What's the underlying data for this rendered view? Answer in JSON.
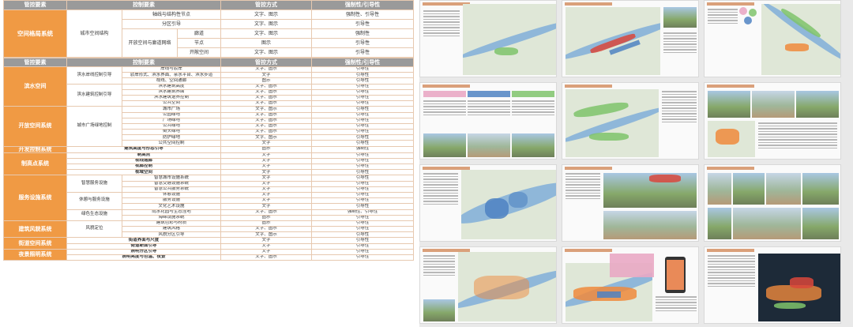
{
  "table_top": {
    "headers": [
      "管控要素",
      "控制要素",
      "管控方式",
      "强制性/引导性"
    ],
    "system": "空间格局系统",
    "group": "城市空间结构",
    "rows": [
      {
        "el": "轴线与结构性节点",
        "sub": "",
        "way": "文字、图示",
        "type": "强制性、引导性"
      },
      {
        "el": "分区引导",
        "sub": "",
        "way": "文字、图示",
        "type": "引导性"
      },
      {
        "el": "开放空间与廊道网络",
        "sub": "廊道",
        "way": "文字、图示",
        "type": "强制性"
      },
      {
        "el": "",
        "sub": "节点",
        "way": "图示",
        "type": "引导性"
      },
      {
        "el": "",
        "sub": "开敞空间",
        "way": "文字、图示",
        "type": "引导性"
      }
    ]
  },
  "table_main": {
    "headers": [
      "管控要素",
      "控制要素",
      "管控方式",
      "强制性/引导性"
    ],
    "systems": [
      {
        "name": "滨水空间",
        "groups": [
          {
            "name": "滨水岸线控制引导",
            "items": [
              {
                "el": "岸线与驳岸",
                "way": "文字、图示",
                "type": "引导性"
              },
              {
                "el": "驳岸形式、滨水界面、亲水平台、滨水步道",
                "way": "文字",
                "type": "引导性"
              },
              {
                "el": "视线、空间通廊",
                "way": "图示",
                "type": "引导性"
              }
            ]
          },
          {
            "name": "滨水建筑控制引导",
            "items": [
              {
                "el": "滨水建筑高度",
                "way": "文字、图示",
                "type": "引导性"
              },
              {
                "el": "滨水建筑界面",
                "way": "文字、图示",
                "type": "引导性"
              },
              {
                "el": "滨水建筑退界控制",
                "way": "文字、图示",
                "type": "引导性"
              },
              {
                "el": "公共空间",
                "way": "文字、图示",
                "type": "引导性"
              }
            ]
          }
        ]
      },
      {
        "name": "开放空间系统",
        "groups": [
          {
            "name": "城市广场绿地控制",
            "items": [
              {
                "el": "城市广场",
                "way": "文字、图示",
                "type": "引导性"
              },
              {
                "el": "公园绿地",
                "way": "文字、图示",
                "type": "引导性"
              },
              {
                "el": "广场绿地",
                "way": "文字、图示",
                "type": "引导性"
              },
              {
                "el": "公共绿地",
                "way": "文字、图示",
                "type": "引导性"
              },
              {
                "el": "街头绿地",
                "way": "文字、图示",
                "type": "引导性"
              },
              {
                "el": "防护绿地",
                "way": "文字、图示",
                "type": "引导性"
              },
              {
                "el": "公共空间控制",
                "way": "文字",
                "type": "引导性"
              }
            ]
          }
        ]
      },
      {
        "name": "开发控制系统",
        "groups": [
          {
            "name": "",
            "items": [
              {
                "el": "建筑高度与形态引导",
                "way": "图示",
                "type": "强制性"
              }
            ]
          }
        ]
      },
      {
        "name": "制高点系统",
        "groups": [
          {
            "name": "",
            "items": [
              {
                "el": "制高点",
                "way": "文字",
                "type": "引导性"
              },
              {
                "el": "视线通廊",
                "way": "文字",
                "type": "引导性"
              },
              {
                "el": "视廊控制",
                "way": "文字",
                "type": "引导性"
              },
              {
                "el": "视域空间",
                "way": "文字",
                "type": "引导性"
              }
            ]
          }
        ]
      },
      {
        "name": "服务设施系统",
        "groups": [
          {
            "name": "智慧服务设施",
            "items": [
              {
                "el": "智慧城市设施系统",
                "way": "文字",
                "type": "引导性"
              },
              {
                "el": "智慧交通设施系统",
                "way": "文字",
                "type": "引导性"
              },
              {
                "el": "智慧公共服务系统",
                "way": "文字",
                "type": "引导性"
              }
            ]
          },
          {
            "name": "休憩与服务设施",
            "items": [
              {
                "el": "休憩设施",
                "way": "文字",
                "type": "引导性"
              },
              {
                "el": "服务设施",
                "way": "文字",
                "type": "引导性"
              },
              {
                "el": "文化艺术设施",
                "way": "文字",
                "type": "引导性"
              }
            ]
          },
          {
            "name": "绿色生态设施",
            "items": [
              {
                "el": "雨水花园与生态洼地",
                "way": "文字、图示",
                "type": "强制性、引导性"
              },
              {
                "el": "海绵设施系统",
                "way": "图示",
                "type": "引导性"
              }
            ]
          }
        ]
      },
      {
        "name": "建筑风貌系统",
        "groups": [
          {
            "name": "风貌定位",
            "items": [
              {
                "el": "建筑色彩与材质",
                "way": "图示",
                "type": "引导性"
              },
              {
                "el": "建筑风格",
                "way": "文字、图示",
                "type": "引导性"
              },
              {
                "el": "风貌分区引导",
                "way": "文字、图示",
                "type": "引导性"
              }
            ]
          }
        ]
      },
      {
        "name": "街道空间系统",
        "groups": [
          {
            "name": "",
            "items": [
              {
                "el": "街道界面与尺度",
                "way": "文字",
                "type": "引导性"
              },
              {
                "el": "街道断面引导",
                "way": "文字",
                "type": "引导性"
              }
            ]
          }
        ]
      },
      {
        "name": "夜景照明系统",
        "groups": [
          {
            "name": "",
            "items": [
              {
                "el": "照明分区引导",
                "way": "文字",
                "type": "引导性"
              },
              {
                "el": "照明亮度与色温、夜景",
                "way": "文字、图示",
                "type": "引导性"
              }
            ]
          }
        ]
      }
    ]
  },
  "thumbnails": [
    {
      "name": "thumb-1"
    },
    {
      "name": "thumb-2"
    },
    {
      "name": "thumb-3"
    },
    {
      "name": "thumb-4"
    },
    {
      "name": "thumb-5"
    },
    {
      "name": "thumb-6"
    },
    {
      "name": "thumb-7"
    },
    {
      "name": "thumb-8"
    },
    {
      "name": "thumb-9"
    },
    {
      "name": "thumb-10"
    },
    {
      "name": "thumb-11"
    },
    {
      "name": "thumb-12"
    }
  ]
}
